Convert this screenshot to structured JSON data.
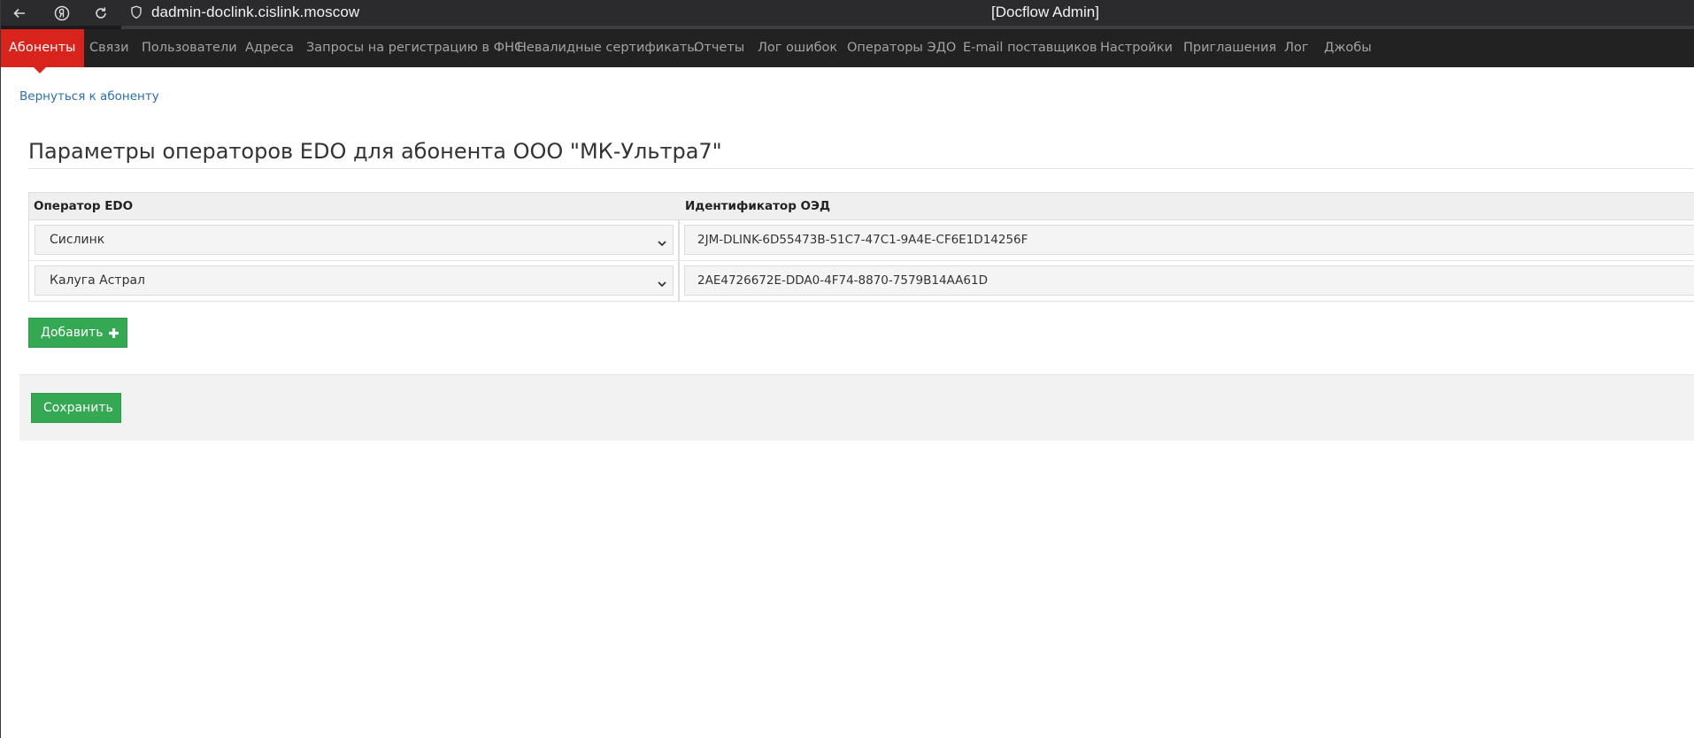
{
  "browser": {
    "url": "dadmin-doclink.cislink.moscow",
    "window_title": "[Docflow Admin]"
  },
  "nav": {
    "items": [
      {
        "label": "Абоненты",
        "active": true
      },
      {
        "label": "Связи"
      },
      {
        "label": "Пользователи"
      },
      {
        "label": "Адреса"
      },
      {
        "label": "Запросы на регистрацию в ФНС"
      },
      {
        "label": "Невалидные сертификаты"
      },
      {
        "label": "Отчеты"
      },
      {
        "label": "Лог ошибок"
      },
      {
        "label": "Операторы ЭДО"
      },
      {
        "label": "E-mail поставщиков"
      },
      {
        "label": "Настройки"
      },
      {
        "label": "Приглашения"
      },
      {
        "label": "Лог"
      },
      {
        "label": "Джобы"
      }
    ]
  },
  "page": {
    "back_link": "Вернуться к абоненту",
    "title": "Параметры операторов EDO для абонента ООО \"МК-Ультра7\""
  },
  "table": {
    "headers": {
      "operator": "Оператор EDO",
      "identifier": "Идентификатор ОЭД"
    },
    "rows": [
      {
        "operator": "Сислинк",
        "identifier": "2JM-DLINK-6D55473B-51C7-47C1-9A4E-CF6E1D14256F"
      },
      {
        "operator": "Калуга Астрал",
        "identifier": "2AE4726672E-DDA0-4F74-8870-7579B14AA61D"
      }
    ]
  },
  "actions": {
    "add_label": "Добавить",
    "save_label": "Сохранить"
  },
  "colors": {
    "nav_active": "#d9231d",
    "button_green": "#34a853",
    "link": "#2a6ea8"
  }
}
